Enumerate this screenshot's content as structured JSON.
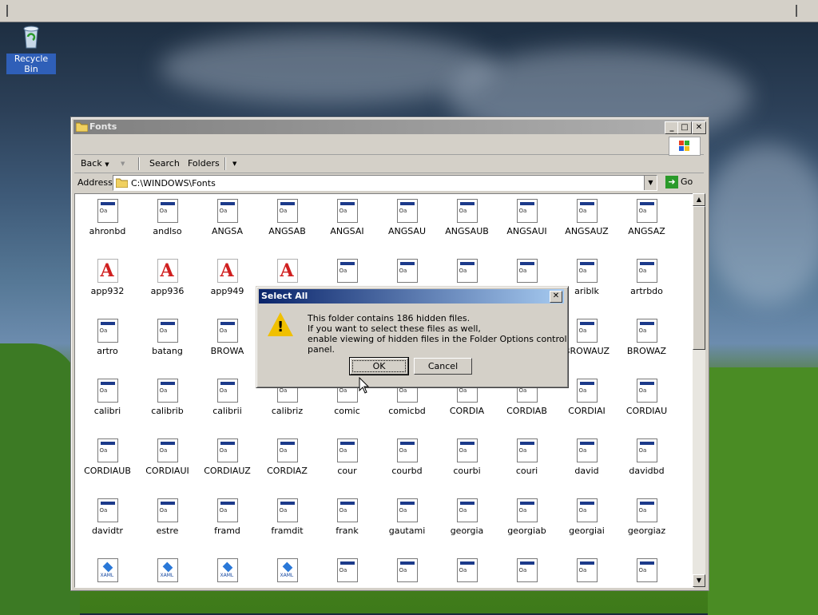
{
  "desktop": {
    "recycle_bin_label": "Recycle Bin"
  },
  "window": {
    "title": "Fonts",
    "toolbar": {
      "back_label": "Back",
      "search_label": "Search",
      "folders_label": "Folders"
    },
    "address": {
      "label": "Address",
      "value": "C:\\WINDOWS\\Fonts",
      "go_label": "Go"
    },
    "files": [
      {
        "name": "ahronbd",
        "type": "font"
      },
      {
        "name": "andlso",
        "type": "font"
      },
      {
        "name": "ANGSA",
        "type": "font"
      },
      {
        "name": "ANGSAB",
        "type": "font"
      },
      {
        "name": "ANGSAI",
        "type": "font"
      },
      {
        "name": "ANGSAU",
        "type": "font"
      },
      {
        "name": "ANGSAUB",
        "type": "font"
      },
      {
        "name": "ANGSAUI",
        "type": "font"
      },
      {
        "name": "ANGSAUZ",
        "type": "font"
      },
      {
        "name": "ANGSAZ",
        "type": "font"
      },
      {
        "name": "app932",
        "type": "raster"
      },
      {
        "name": "app936",
        "type": "raster"
      },
      {
        "name": "app949",
        "type": "raster"
      },
      {
        "name": "",
        "type": "raster"
      },
      {
        "name": "",
        "type": "font"
      },
      {
        "name": "",
        "type": "font"
      },
      {
        "name": "",
        "type": "font"
      },
      {
        "name": "",
        "type": "font"
      },
      {
        "name": "ariblk",
        "type": "font"
      },
      {
        "name": "artrbdo",
        "type": "font"
      },
      {
        "name": "artro",
        "type": "font"
      },
      {
        "name": "batang",
        "type": "font"
      },
      {
        "name": "BROWA",
        "type": "font"
      },
      {
        "name": "",
        "type": "font"
      },
      {
        "name": "",
        "type": "font"
      },
      {
        "name": "",
        "type": "font"
      },
      {
        "name": "",
        "type": "font"
      },
      {
        "name": "",
        "type": "font"
      },
      {
        "name": "BROWAUZ",
        "type": "font"
      },
      {
        "name": "BROWAZ",
        "type": "font"
      },
      {
        "name": "calibri",
        "type": "font"
      },
      {
        "name": "calibrib",
        "type": "font"
      },
      {
        "name": "calibrii",
        "type": "font"
      },
      {
        "name": "calibriz",
        "type": "font"
      },
      {
        "name": "comic",
        "type": "font"
      },
      {
        "name": "comicbd",
        "type": "font"
      },
      {
        "name": "CORDIA",
        "type": "font"
      },
      {
        "name": "CORDIAB",
        "type": "font"
      },
      {
        "name": "CORDIAI",
        "type": "font"
      },
      {
        "name": "CORDIAU",
        "type": "font"
      },
      {
        "name": "CORDIAUB",
        "type": "font"
      },
      {
        "name": "CORDIAUI",
        "type": "font"
      },
      {
        "name": "CORDIAUZ",
        "type": "font"
      },
      {
        "name": "CORDIAZ",
        "type": "font"
      },
      {
        "name": "cour",
        "type": "font"
      },
      {
        "name": "courbd",
        "type": "font"
      },
      {
        "name": "courbi",
        "type": "font"
      },
      {
        "name": "couri",
        "type": "font"
      },
      {
        "name": "david",
        "type": "font"
      },
      {
        "name": "davidbd",
        "type": "font"
      },
      {
        "name": "davidtr",
        "type": "font"
      },
      {
        "name": "estre",
        "type": "font"
      },
      {
        "name": "framd",
        "type": "font"
      },
      {
        "name": "framdit",
        "type": "font"
      },
      {
        "name": "frank",
        "type": "font"
      },
      {
        "name": "gautami",
        "type": "font"
      },
      {
        "name": "georgia",
        "type": "font"
      },
      {
        "name": "georgiab",
        "type": "font"
      },
      {
        "name": "georgiai",
        "type": "font"
      },
      {
        "name": "georgiaz",
        "type": "font"
      },
      {
        "name": "",
        "type": "xaml"
      },
      {
        "name": "",
        "type": "xaml"
      },
      {
        "name": "",
        "type": "xaml"
      },
      {
        "name": "",
        "type": "xaml"
      },
      {
        "name": "",
        "type": "font"
      },
      {
        "name": "",
        "type": "font"
      },
      {
        "name": "",
        "type": "font"
      },
      {
        "name": "",
        "type": "font"
      },
      {
        "name": "",
        "type": "font"
      },
      {
        "name": "",
        "type": "font"
      }
    ]
  },
  "dialog": {
    "title": "Select All",
    "line1": "This folder contains 186 hidden files.",
    "line2": "If you want to select these files as well,",
    "line3": "enable viewing of hidden files in the Folder Options control panel.",
    "ok_label": "OK",
    "cancel_label": "Cancel"
  },
  "icons": {
    "font_icon_text": "Oa",
    "raster_icon_text": "A",
    "xaml_icon_text": "XAML"
  },
  "colors": {
    "dialog_title": "#0a246a",
    "window_inactive_title": "#808080",
    "warning": "#f0c000"
  }
}
